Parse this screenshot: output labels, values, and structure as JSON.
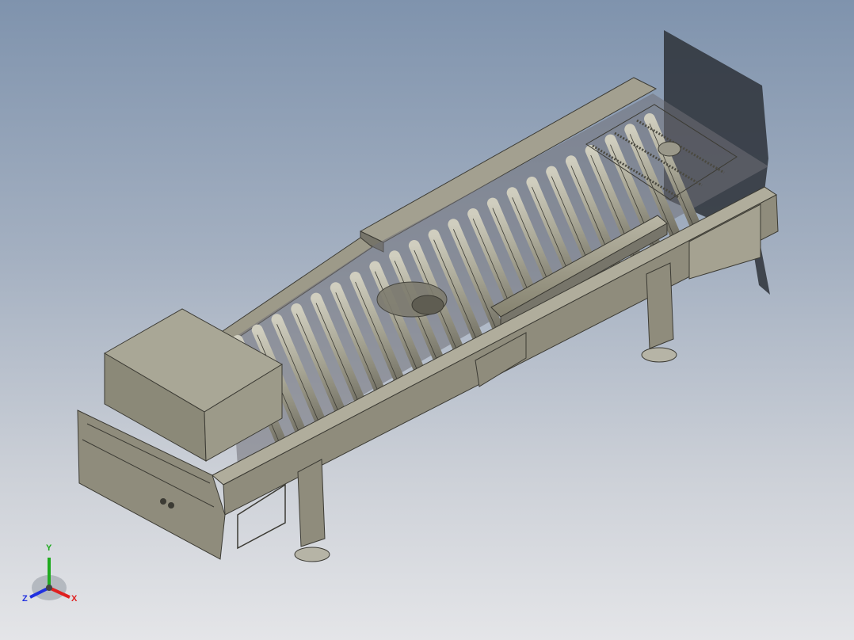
{
  "viewport": {
    "background_top": "#7f93ad",
    "background_bottom": "#e4e5e8"
  },
  "model": {
    "parts": [
      "roller-conveyor-frame",
      "conveyor-rollers",
      "side-guard-rail",
      "transfer-belt-chain",
      "cardboard-box-load",
      "support-legs",
      "leveling-feet",
      "drive-motor"
    ],
    "colors": {
      "metal": "#8f8c7c",
      "metal_light": "#b3b09f",
      "metal_dark": "#5f5d52",
      "box_top": "#a9a796",
      "box_side": "#8b8978",
      "shadow": "#2d3138"
    }
  },
  "triad": {
    "x_label": "X",
    "y_label": "Y",
    "z_label": "Z",
    "x_color": "#e02020",
    "y_color": "#1faa1f",
    "z_color": "#2030e0"
  }
}
